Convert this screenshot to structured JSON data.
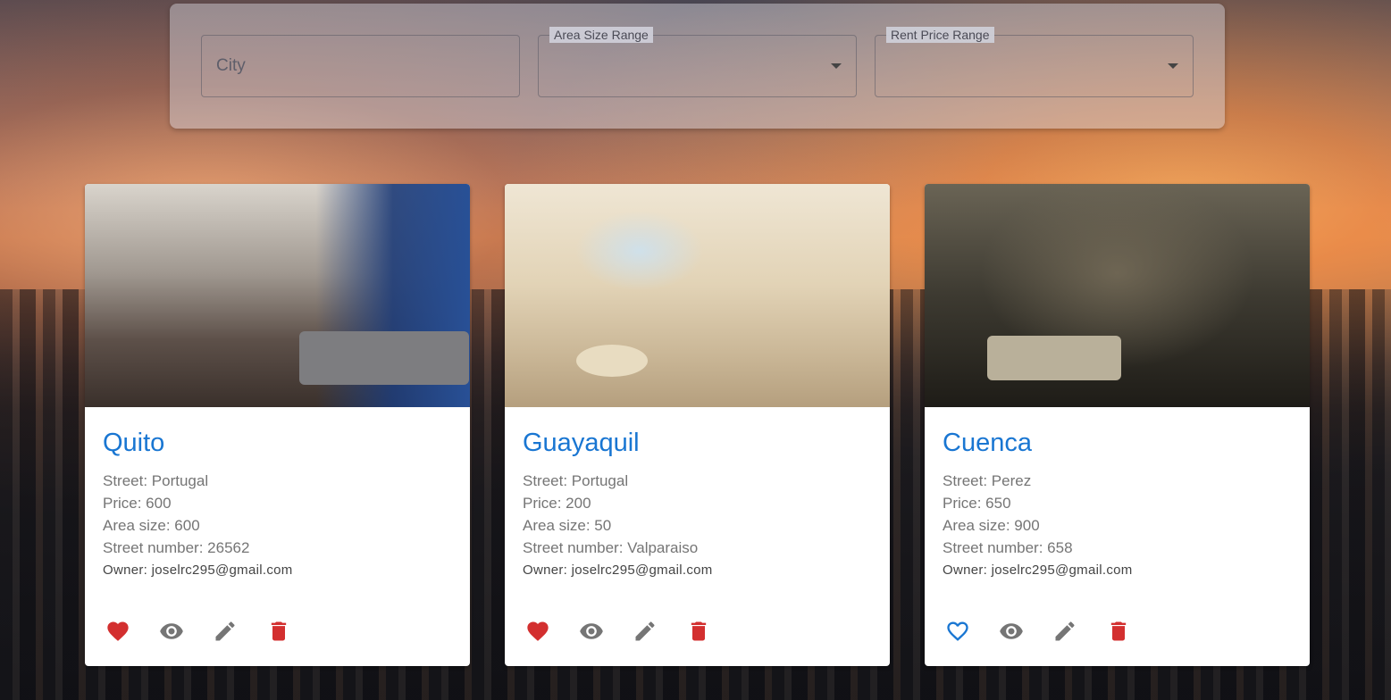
{
  "filters": {
    "city_placeholder": "City",
    "area_size_label": "Area Size Range",
    "rent_price_label": "Rent Price Range"
  },
  "colors": {
    "title": "#1976d2",
    "favorite_filled": "#d32f2f",
    "favorite_outline": "#1976d2",
    "icon_gray": "#757575",
    "delete": "#d32f2f"
  },
  "cards": [
    {
      "city": "Quito",
      "street": "Street: Portugal",
      "price": "Price: 600",
      "area": "Area size: 600",
      "street_number": "Street number: 26562",
      "owner": "Owner: joselrc295@gmail.com",
      "favorite": true
    },
    {
      "city": "Guayaquil",
      "street": "Street: Portugal",
      "price": "Price: 200",
      "area": "Area size: 50",
      "street_number": "Street number: Valparaiso",
      "owner": "Owner: joselrc295@gmail.com",
      "favorite": true
    },
    {
      "city": "Cuenca",
      "street": "Street: Perez",
      "price": "Price: 650",
      "area": "Area size: 900",
      "street_number": "Street number: 658",
      "owner": "Owner: joselrc295@gmail.com",
      "favorite": false
    }
  ],
  "icons": [
    "heart-icon",
    "eye-icon",
    "pencil-icon",
    "trash-icon"
  ]
}
